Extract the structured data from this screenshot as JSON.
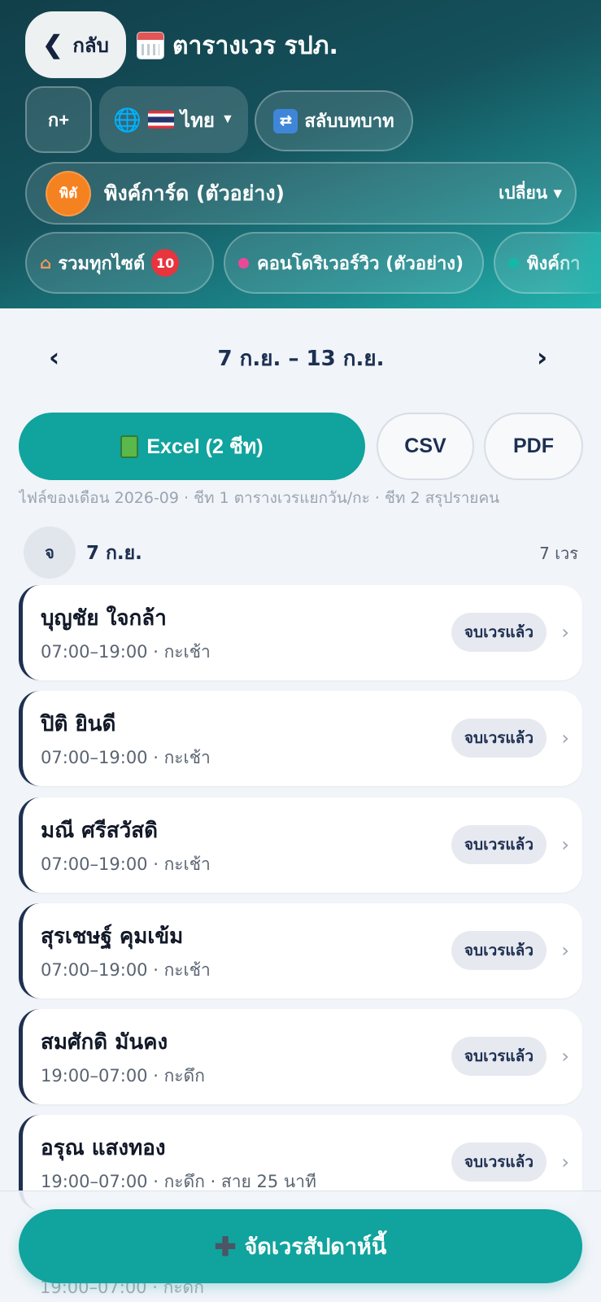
{
  "header": {
    "back_label": "กลับ",
    "title": "ตารางเวร รปภ.",
    "font_button": "ก+",
    "language": "ไทย",
    "switch_role": "สลับบทบาท",
    "company_avatar": "พิตั",
    "company_name": "พิงค์การ์ด (ตัวอย่าง)",
    "change_label": "เปลี่ยน ▾",
    "sites": [
      {
        "label": "รวมทุกไซต์",
        "badge": "10"
      },
      {
        "label": "คอนโดริเวอร์วิว (ตัวอย่าง)",
        "dot_color": "#ec4899"
      },
      {
        "label": "พิงค์กา",
        "dot_color": "#14b8a6"
      }
    ]
  },
  "week": {
    "prev": "‹",
    "range": "7 ก.ย. – 13 ก.ย.",
    "next": "›"
  },
  "export": {
    "excel": "Excel (2 ชีท)",
    "csv": "CSV",
    "pdf": "PDF",
    "note": "ไฟล์ของเดือน 2026-09 · ชีท 1 ตารางเวรแยกวัน/กะ · ชีท 2 สรุปรายคน"
  },
  "day": {
    "weekday": "จ",
    "date": "7 ก.ย.",
    "count": "7 เวร"
  },
  "shifts": [
    {
      "name": "บุญชัย ใจกล้า",
      "time": "07:00–19:00 · กะเช้า",
      "status": "จบเวรแล้ว"
    },
    {
      "name": "ปิติ ยินดี",
      "time": "07:00–19:00 · กะเช้า",
      "status": "จบเวรแล้ว"
    },
    {
      "name": "มณี ศรีสวัสดิ",
      "time": "07:00–19:00 · กะเช้า",
      "status": "จบเวรแล้ว"
    },
    {
      "name": "สุรเชษฐ์ คุมเข้ม",
      "time": "07:00–19:00 · กะเช้า",
      "status": "จบเวรแล้ว"
    },
    {
      "name": "สมศักดิ มันคง",
      "time": "19:00–07:00 · กะดึก",
      "status": "จบเวรแล้ว"
    },
    {
      "name": "อรุณ แสงทอง",
      "time": "19:00–07:00 · กะดึก · สาย 25 นาที",
      "status": "จบเวรแล้ว"
    }
  ],
  "peek_time": "19:00–07:00 · กะดึก",
  "bottom": {
    "assign_label": "จัดเวรสัปดาห์นี้"
  },
  "colors": {
    "accent": "#11a39e",
    "header_dark": "#113f4a",
    "company_avatar": "#f58220",
    "badge": "#e8343d"
  }
}
